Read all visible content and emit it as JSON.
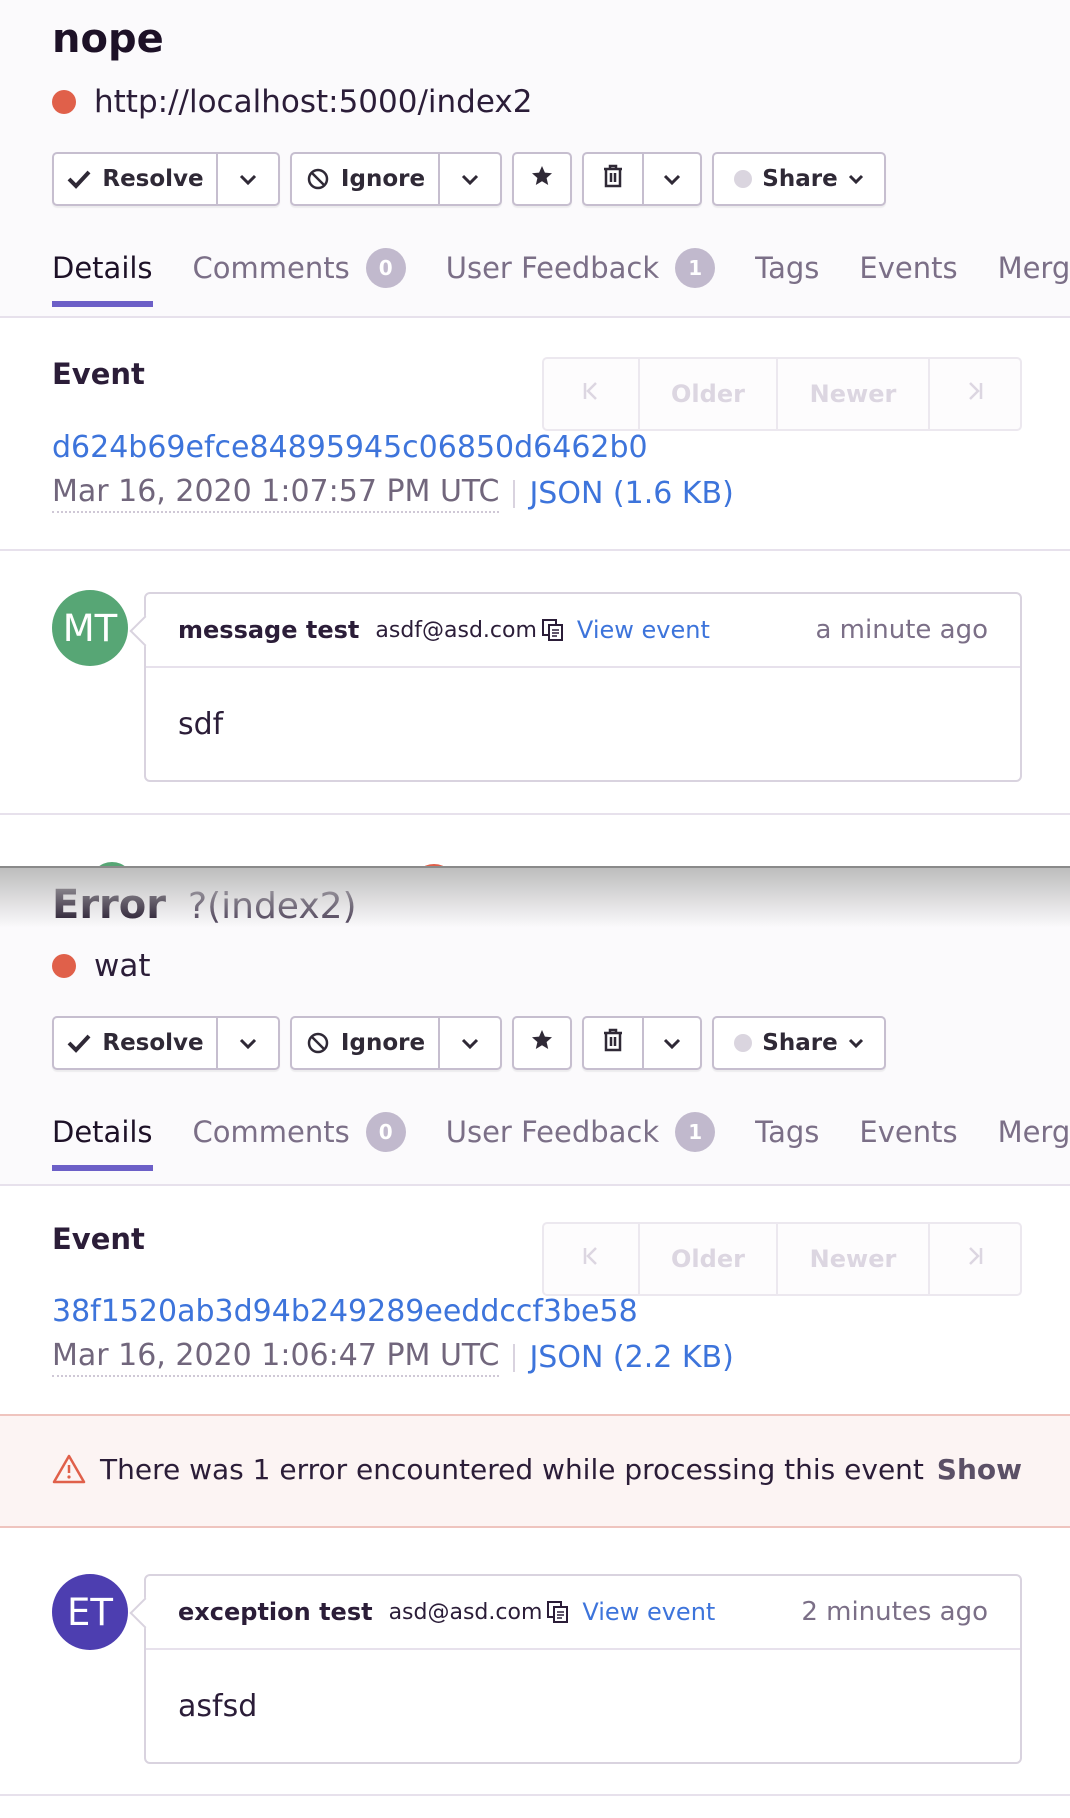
{
  "toolbar": {
    "resolve_label": "Resolve",
    "ignore_label": "Ignore",
    "share_label": "Share"
  },
  "tabs": {
    "details": "Details",
    "comments": "Comments",
    "comments_count": "0",
    "user_feedback": "User Feedback",
    "user_feedback_count": "1",
    "tags": "Tags",
    "events": "Events",
    "merged": "Merged"
  },
  "pager": {
    "older": "Older",
    "newer": "Newer"
  },
  "event_label": "Event",
  "colors": {
    "accent": "#6c5fc7",
    "link": "#3d74db",
    "level_error": "#e0604a",
    "avatar_mt": "#57a675",
    "avatar_et": "#4d3eb0"
  },
  "issue_a": {
    "title": "nope",
    "culprit": "http://localhost:5000/index2",
    "event_id": "d624b69efce84895945c06850d6462b0",
    "date": "Mar 16, 2020 1:07:57 PM UTC",
    "json": "JSON (1.6 KB)",
    "feedback": {
      "initials": "MT",
      "name": "message test",
      "email": "asdf@asd.com",
      "view_event": "View event",
      "time": "a minute ago",
      "comment": "sdf"
    }
  },
  "issue_b": {
    "title": "Error",
    "subtitle": "?(index2)",
    "culprit": "wat",
    "event_id": "38f1520ab3d94b249289eeddccf3be58",
    "date": "Mar 16, 2020 1:06:47 PM UTC",
    "json": "JSON (2.2 KB)",
    "error_banner": {
      "text": "There was 1 error encountered while processing this event",
      "show": "Show"
    },
    "feedback": {
      "initials": "ET",
      "name": "exception test",
      "email": "asd@asd.com",
      "view_event": "View event",
      "time": "2 minutes ago",
      "comment": "asfsd"
    }
  }
}
